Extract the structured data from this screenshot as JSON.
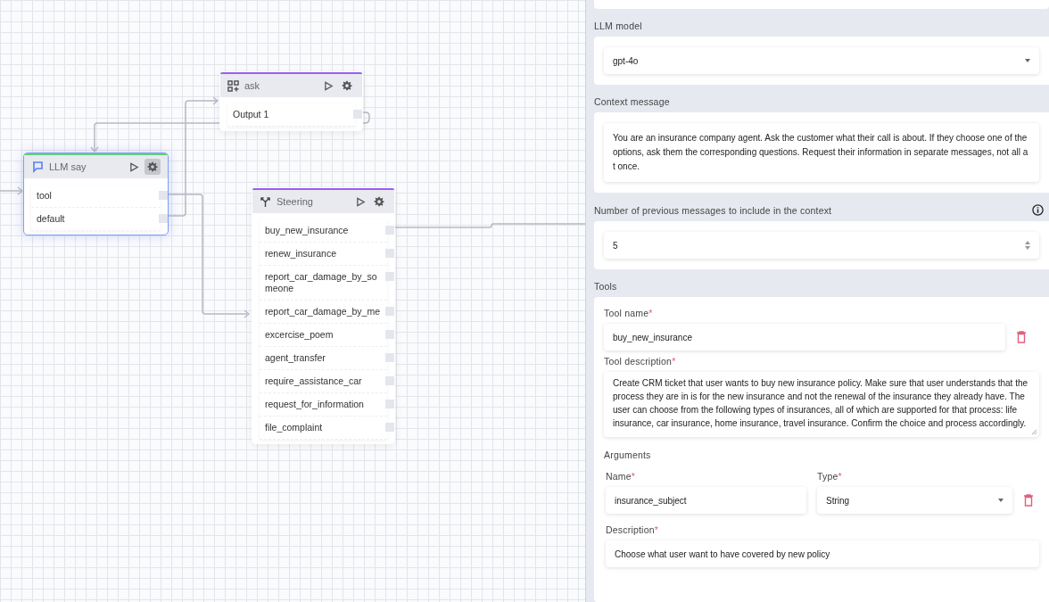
{
  "canvas": {
    "nodes": [
      {
        "kind": "llm",
        "title": "LLM say",
        "selected": true,
        "outputs": [
          "tool",
          "default"
        ]
      },
      {
        "kind": "ask",
        "title": "ask",
        "selected": false,
        "outputs": [
          "Output 1"
        ]
      },
      {
        "kind": "steering",
        "title": "Steering",
        "selected": false,
        "outputs": [
          "buy_new_insurance",
          "renew_insurance",
          "report_car_damage_by_someone",
          "report_car_damage_by_me",
          "excercise_poem",
          "agent_transfer",
          "require_assistance_car",
          "request_for_information",
          "file_complaint"
        ]
      }
    ]
  },
  "panel": {
    "llm_model": {
      "label": "LLM model",
      "value": "gpt-4o"
    },
    "context_message": {
      "label": "Context message",
      "value": "You are an insurance company agent. Ask the customer what their call is about. If they choose one of the options, ask them the corresponding questions. Request their information in separate messages, not all at once."
    },
    "previous_messages": {
      "label": "Number of previous messages to include in the context",
      "value": "5"
    },
    "tools": {
      "label": "Tools",
      "items": [
        {
          "name_label": "Tool name",
          "name_required_mark": "*",
          "name": "buy_new_insurance",
          "description_label": "Tool description",
          "description_required_mark": "*",
          "description": "Create CRM ticket that user wants to buy new insurance policy. Make sure that user understands that the process they are in is for the new insurance and not the renewal of the insurance they already have. The user can choose from the following types of insurances, all of which are supported for that process: life insurance, car insurance, home insurance, travel insurance. Confirm the choice and process accordingly.",
          "arguments_label": "Arguments",
          "arguments": [
            {
              "name_label": "Name",
              "name_required_mark": "*",
              "name": "insurance_subject",
              "type_label": "Type",
              "type_required_mark": "*",
              "type": "String",
              "description_label": "Description",
              "description_required_mark": "*",
              "description": "Choose what user want to have covered by new policy"
            }
          ]
        }
      ]
    }
  }
}
